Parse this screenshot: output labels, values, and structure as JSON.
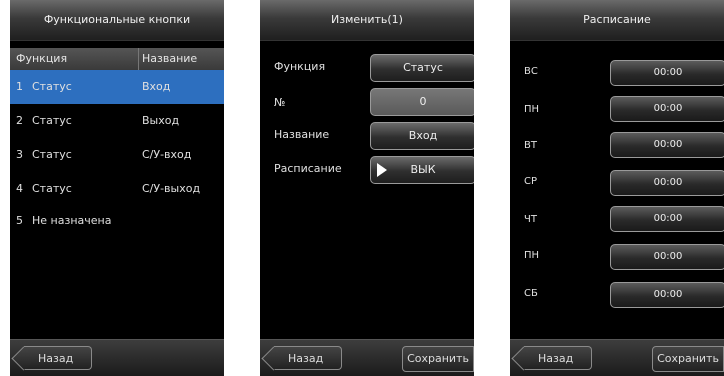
{
  "panel1": {
    "title": "Функциональные кнопки",
    "col_function": "Функция",
    "col_name": "Название",
    "rows": [
      {
        "num": "1",
        "func": "Статус",
        "name": "Вход"
      },
      {
        "num": "2",
        "func": "Статус",
        "name": "Выход"
      },
      {
        "num": "3",
        "func": "Статус",
        "name": "С/У-вход"
      },
      {
        "num": "4",
        "func": "Статус",
        "name": "С/У-выход"
      },
      {
        "num": "5",
        "func": "Не назначена",
        "name": ""
      }
    ],
    "back_label": "Назад",
    "selected_color": "#2d6fbf"
  },
  "panel2": {
    "title": "Изменить(1)",
    "fields": [
      {
        "label": "Функция",
        "value": "Статус"
      },
      {
        "label": "№",
        "value": "0"
      },
      {
        "label": "Название",
        "value": "Вход"
      },
      {
        "label": "Расписание",
        "value": "ВЫК"
      }
    ],
    "back_label": "Назад",
    "save_label": "Сохранить"
  },
  "panel3": {
    "title": "Расписание",
    "days": [
      {
        "day": "ВС",
        "time": "00:00"
      },
      {
        "day": "ПН",
        "time": "00:00"
      },
      {
        "day": "ВТ",
        "time": "00:00"
      },
      {
        "day": "СР",
        "time": "00:00"
      },
      {
        "day": "ЧТ",
        "time": "00:00"
      },
      {
        "day": "ПН",
        "time": "00:00"
      },
      {
        "day": "СБ",
        "time": "00:00"
      }
    ],
    "back_label": "Назад",
    "save_label": "Сохранить"
  }
}
